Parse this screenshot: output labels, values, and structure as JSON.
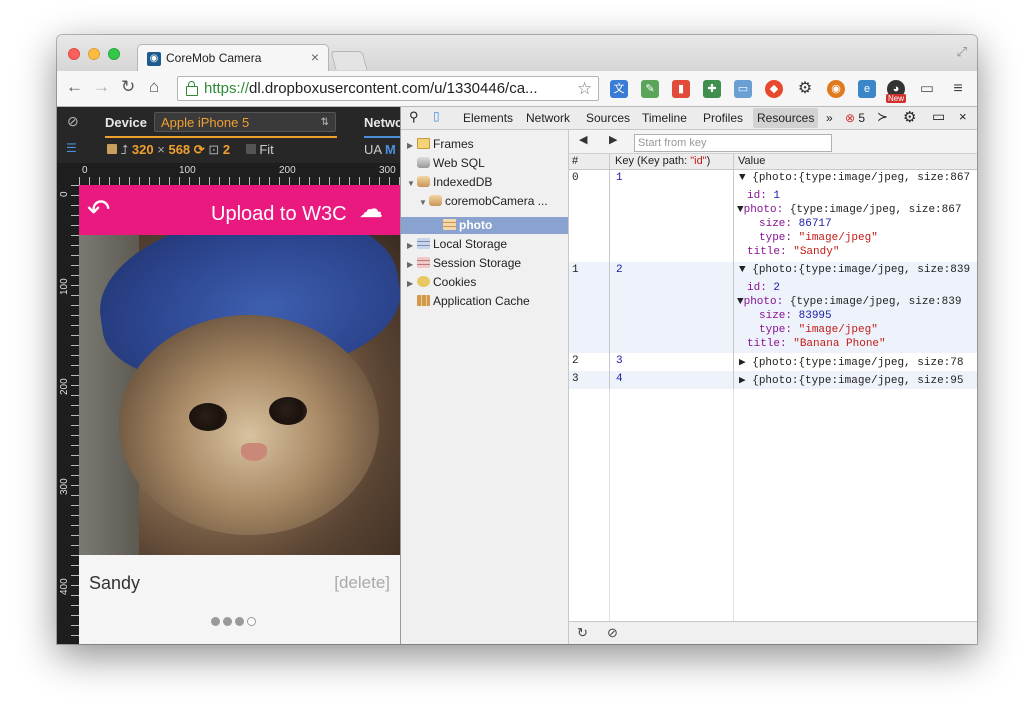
{
  "browser": {
    "tab_title": "CoreMob Camera",
    "url_https": "https://",
    "url_rest": "dl.dropboxusercontent.com/u/1330446/ca...",
    "new_badge": "New"
  },
  "emulation": {
    "device_label": "Device",
    "device_value": "Apple iPhone 5",
    "width": "320",
    "times": "×",
    "height": "568",
    "scale": "2",
    "fit_label": "Fit",
    "network_label": "Netwo",
    "ua_label": "UA",
    "ua_value": "M",
    "ruler_top": [
      "0",
      "100",
      "200",
      "300"
    ],
    "ruler_left": [
      "0",
      "100",
      "200",
      "300",
      "400"
    ]
  },
  "app": {
    "upload_label": "Upload to W3C",
    "caption": "Sandy",
    "delete_label": "[delete]",
    "pager_total": 4,
    "pager_current": 4
  },
  "devtools": {
    "tabs": [
      "Elements",
      "Network",
      "Sources",
      "Timeline",
      "Profiles",
      "Resources"
    ],
    "active_tab": "Resources",
    "more": "»",
    "error_count": "5",
    "sidebar": {
      "frames": "Frames",
      "websql": "Web SQL",
      "indexeddb": "IndexedDB",
      "db": "coremobCamera ...",
      "store": "photo",
      "local": "Local Storage",
      "session": "Session Storage",
      "cookies": "Cookies",
      "appcache": "Application Cache"
    },
    "start_key_placeholder": "Start from key",
    "columns": {
      "index": "#",
      "key_prefix": "Key (Key path: ",
      "key_path": "\"id\"",
      "key_suffix": ")",
      "value": "Value"
    },
    "rows": [
      {
        "index": "0",
        "key": "1",
        "summary": "{photo:{type:image/jpeg, size:867",
        "id_label": "id:",
        "id": "1",
        "photo_label": "photo:",
        "photo_summary": "{type:image/jpeg, size:867",
        "size_label": "size:",
        "size": "86717",
        "type_label": "type:",
        "type": "\"image/jpeg\"",
        "title_label": "title:",
        "title": "\"Sandy\""
      },
      {
        "index": "1",
        "key": "2",
        "summary": "{photo:{type:image/jpeg, size:839",
        "id_label": "id:",
        "id": "2",
        "photo_label": "photo:",
        "photo_summary": "{type:image/jpeg, size:839",
        "size_label": "size:",
        "size": "83995",
        "type_label": "type:",
        "type": "\"image/jpeg\"",
        "title_label": "title:",
        "title": "\"Banana Phone\""
      },
      {
        "index": "2",
        "key": "3",
        "summary": "{photo:{type:image/jpeg, size:78"
      },
      {
        "index": "3",
        "key": "4",
        "summary": "{photo:{type:image/jpeg, size:95"
      }
    ]
  },
  "colors": {
    "accent_pink": "#e9197f",
    "device_orange": "#f0a030",
    "selection": "#8aa2cf"
  }
}
